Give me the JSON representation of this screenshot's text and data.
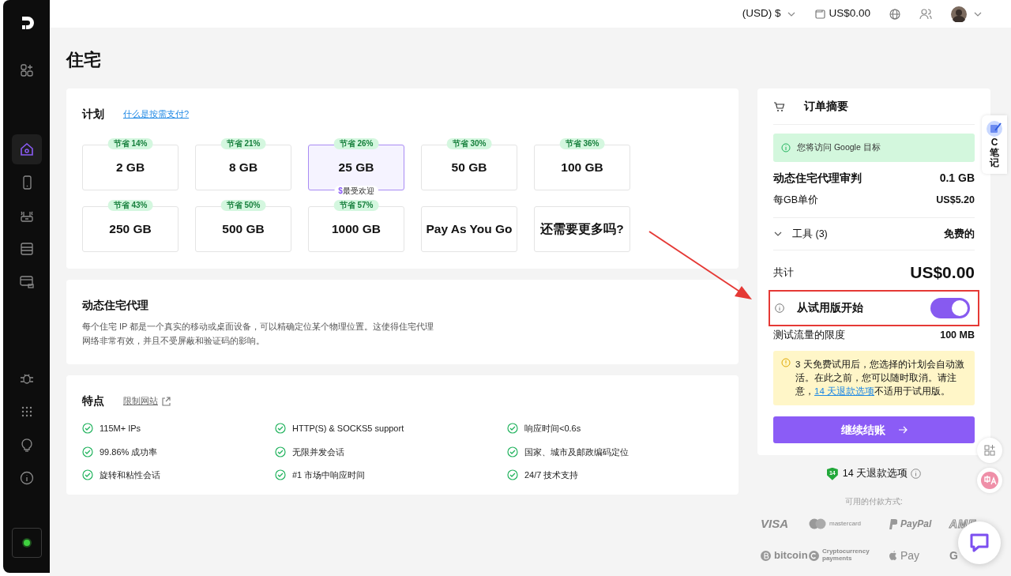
{
  "topbar": {
    "currency": "(USD) $",
    "balance": "US$0.00"
  },
  "sidebar": {
    "groups": [
      {
        "items": [
          {
            "selected": false
          }
        ]
      },
      {
        "items": [
          {
            "selected": true
          },
          {
            "selected": false
          },
          {
            "selected": false
          },
          {
            "selected": false
          },
          {
            "selected": false
          }
        ]
      },
      {
        "items": [
          {
            "selected": false
          },
          {
            "selected": false
          },
          {
            "selected": false
          },
          {
            "selected": false
          }
        ]
      }
    ],
    "status_online": true
  },
  "page_title": "住宅",
  "plans": {
    "title": "计划",
    "help_link": "什么是按需支付?",
    "items": [
      {
        "label": "2 GB",
        "discount": "节省 14%",
        "selected": false
      },
      {
        "label": "8 GB",
        "discount": "节省 21%",
        "selected": false
      },
      {
        "label": "25 GB",
        "discount": "节省 26%",
        "selected": true,
        "tag_icon": "$",
        "tag": "最受欢迎"
      },
      {
        "label": "50 GB",
        "discount": "节省 30%",
        "selected": false
      },
      {
        "label": "100 GB",
        "discount": "节省 36%",
        "selected": false
      },
      {
        "label": "250 GB",
        "discount": "节省 43%",
        "selected": false
      },
      {
        "label": "500 GB",
        "discount": "节省 50%",
        "selected": false
      },
      {
        "label": "1000 GB",
        "discount": "节省 57%",
        "selected": false
      },
      {
        "label": "Pay As You Go",
        "selected": false
      },
      {
        "label": "还需要更多吗?",
        "selected": false
      }
    ]
  },
  "about": {
    "title": "动态住宅代理",
    "text": "每个住宅 IP 都是一个真实的移动或桌面设备，可以精确定位某个物理位置。这使得住宅代理网络非常有效，并且不受屏蔽和验证码的影响。"
  },
  "features": {
    "title": "特点",
    "link": "限制网站",
    "items": [
      "115M+ IPs",
      "HTTP(S) & SOCKS5 support",
      "响应时间<0.6s",
      "99.86% 成功率",
      "无限并发会话",
      "国家、城市及邮政编码定位",
      "旋转和粘性会话",
      "#1 市场中响应时间",
      "24/7 技术支持"
    ]
  },
  "order": {
    "title": "订单摘要",
    "notice": "您将访问 Google 目标",
    "product": "动态住宅代理审判",
    "product_amount": "0.1 GB",
    "unit_label": "每GB单价",
    "unit_price": "US$5.20",
    "tools_label": "工具 (3)",
    "tools_expanded": false,
    "tools_price": "免费的",
    "total_label": "共计",
    "total": "US$0.00",
    "trial_label": "从试用版开始",
    "trial_on": true,
    "limit_label": "测试流量的限度",
    "limit": "100 MB",
    "trial_note_before": "3 天免费试用后，您选择的计划会自动激活。在此之前，您可以随时取消。请注意，",
    "trial_note_link": "14 天退款选项",
    "trial_note_after": "不适用于试用版。",
    "checkout": "继续结账"
  },
  "refund": {
    "badge": "14",
    "text": "14 天退款选项"
  },
  "payments": {
    "title": "可用的付款方式:",
    "logos": [
      {
        "kind": "visa",
        "text": "VISA"
      },
      {
        "kind": "mastercard",
        "text": "mastercard"
      },
      {
        "kind": "paypal",
        "text": "PayPal"
      },
      {
        "kind": "amex",
        "text": "AME"
      },
      {
        "kind": "bitcoin",
        "text": "bitcoin"
      },
      {
        "kind": "crypto",
        "text": "Cryptocurrency payments"
      },
      {
        "kind": "applepay",
        "text": "Pay"
      },
      {
        "kind": "gpay",
        "text": "G"
      }
    ]
  },
  "widgets": {
    "note": "C笔记"
  },
  "annotation": {
    "arrow": true,
    "highlight": true
  }
}
